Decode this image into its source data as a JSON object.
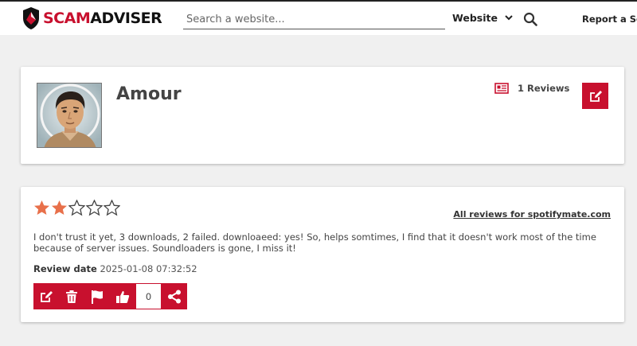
{
  "header": {
    "logo_part1": "SCAM",
    "logo_part2": "ADVISER",
    "search_placeholder": "Search a website...",
    "website_label": "Website",
    "report_label": "Report a Sca"
  },
  "profile": {
    "name": "Amour",
    "reviews_count": "1 Reviews"
  },
  "review": {
    "rating": 2,
    "max_rating": 5,
    "all_reviews_link": "All reviews for spotifymate.com",
    "text": "I don't trust it yet, 3 downloads, 2 failed. downloaeed: yes! So, helps somtimes, I find that it doesn't work most of the time because of server issues. Soundloaders is gone, I miss it!",
    "date_label": "Review date",
    "date_value": "2025-01-08 07:32:52",
    "like_count": "0"
  },
  "colors": {
    "brand_red": "#c8102e",
    "star_filled": "#e8704a",
    "background": "#f0f0f0"
  },
  "icons": [
    "shield-logo-icon",
    "chevron-down-icon",
    "search-icon",
    "reviews-list-icon",
    "edit-icon",
    "star-icon",
    "delete-icon",
    "flag-icon",
    "thumbs-up-icon",
    "share-icon"
  ]
}
